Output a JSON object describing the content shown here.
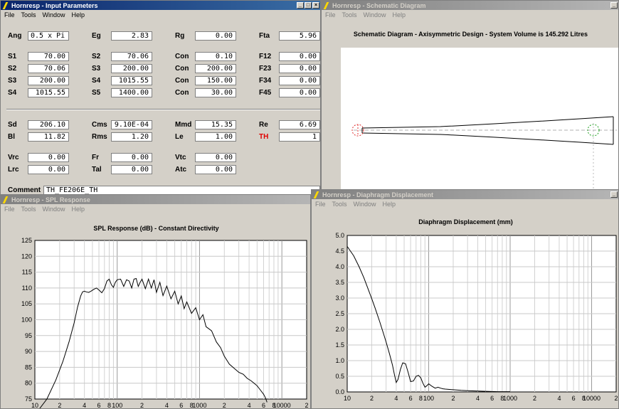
{
  "app_name": "Hornresp",
  "menus": [
    "File",
    "Tools",
    "Window",
    "Help"
  ],
  "windows": {
    "input": {
      "title": "Hornresp - Input Parameters"
    },
    "schematic": {
      "title": "Hornresp - Schematic Diagram",
      "heading": "Schematic Diagram - Axisymmetric Design - System Volume is 145.292 Litres"
    },
    "spl": {
      "title": "Hornresp - SPL Response"
    },
    "disp": {
      "title": "Hornresp - Diaphragm Displacement"
    }
  },
  "params": {
    "Ang": "0.5 x Pi",
    "Eg": "2.83",
    "Rg": "0.00",
    "Fta": "5.96",
    "S1a": "70.00",
    "S2a": "70.06",
    "Con1": "0.10",
    "F12": "0.00",
    "S2b": "70.06",
    "S3a": "200.00",
    "Con2": "200.00",
    "F23": "0.00",
    "S3b": "200.00",
    "S4a": "1015.55",
    "Con3": "150.00",
    "F34": "0.00",
    "S4b": "1015.55",
    "S5": "1400.00",
    "Con4": "30.00",
    "F45": "0.00",
    "Sd": "206.10",
    "Cms": "9.10E-04",
    "Mmd": "15.35",
    "Re": "6.69",
    "Bl": "11.82",
    "Rms": "1.20",
    "Le": "1.00",
    "TH": "1",
    "Vrc": "0.00",
    "Fr": "0.00",
    "Vtc": "0.00",
    "Lrc": "0.00",
    "Tal": "0.00",
    "Atc": "0.00",
    "Comment": "TH_FE206E_TH"
  },
  "labels": {
    "Ang": "Ang",
    "Eg": "Eg",
    "Rg": "Rg",
    "Fta": "Fta",
    "S1": "S1",
    "S2": "S2",
    "S3": "S3",
    "S4": "S4",
    "S5": "S5",
    "Con": "Con",
    "F12": "F12",
    "F23": "F23",
    "F34": "F34",
    "F45": "F45",
    "Sd": "Sd",
    "Cms": "Cms",
    "Mmd": "Mmd",
    "Re": "Re",
    "Bl": "Bl",
    "Rms": "Rms",
    "Le": "Le",
    "TH": "TH",
    "Vrc": "Vrc",
    "Fr": "Fr",
    "Vtc": "Vtc",
    "Lrc": "Lrc",
    "Tal": "Tal",
    "Atc": "Atc",
    "Comment": "Comment"
  },
  "colors": {
    "th_label": "#e00000",
    "title_active": "#0a246a",
    "source_circle": "#e03030",
    "mouth_circle": "#20a020"
  },
  "chart_data": [
    {
      "type": "line",
      "title": "SPL Response (dB) - Constant Directivity",
      "xscale": "log",
      "xlim": [
        10,
        20000
      ],
      "ylim": [
        75,
        125
      ],
      "yticks": [
        75,
        80,
        85,
        90,
        95,
        100,
        105,
        110,
        115,
        120,
        125
      ],
      "xtick_labels": [
        "10",
        "2",
        "4",
        "6",
        "8",
        "100",
        "2",
        "4",
        "6",
        "8",
        "1000",
        "2",
        "4",
        "6",
        "8",
        "10000",
        "2"
      ],
      "x": [
        10,
        14,
        18,
        22,
        26,
        30,
        33,
        36,
        38,
        40,
        42,
        45,
        48,
        52,
        56,
        60,
        65,
        70,
        75,
        80,
        85,
        90,
        95,
        100,
        110,
        120,
        130,
        140,
        150,
        160,
        170,
        180,
        190,
        200,
        220,
        240,
        260,
        280,
        300,
        330,
        360,
        400,
        450,
        500,
        550,
        600,
        650,
        700,
        800,
        900,
        1000,
        1100,
        1200,
        1400,
        1600,
        1800,
        2000,
        2300,
        2600,
        3000,
        3400,
        3800,
        4200,
        4600,
        5000,
        5500,
        6000,
        6300,
        6600
      ],
      "y": [
        70,
        75,
        81,
        87,
        93,
        99,
        104,
        107.5,
        108.8,
        109,
        108.8,
        108.6,
        109,
        109.6,
        110,
        109.4,
        108.5,
        109.8,
        112.2,
        112.8,
        111,
        110.2,
        111.8,
        112.6,
        112.8,
        110.5,
        112.6,
        112.2,
        110,
        112.8,
        113,
        110.5,
        111.8,
        112.8,
        109.8,
        112.8,
        110,
        112.6,
        108.6,
        111.8,
        107.6,
        110.6,
        106.6,
        109,
        105,
        107.5,
        103.5,
        105.6,
        102,
        103.8,
        100,
        101.6,
        97.8,
        96.5,
        93,
        91.2,
        88.5,
        86,
        84.8,
        83.4,
        82.8,
        81.5,
        80.8,
        80,
        79.2,
        77.8,
        76.5,
        75.5,
        74
      ]
    },
    {
      "type": "line",
      "title": "Diaphragm Displacement (mm)",
      "xscale": "log",
      "xlim": [
        10,
        20000
      ],
      "ylim": [
        0,
        5
      ],
      "yticks": [
        "0.0",
        "0.5",
        "1.0",
        "1.5",
        "2.0",
        "2.5",
        "3.0",
        "3.5",
        "4.0",
        "4.5",
        "5.0"
      ],
      "xtick_labels": [
        "10",
        "2",
        "4",
        "6",
        "8",
        "100",
        "2",
        "4",
        "6",
        "8",
        "1000",
        "2",
        "4",
        "6",
        "8",
        "10000",
        "2"
      ],
      "x": [
        10,
        12,
        14,
        16,
        18,
        20,
        22,
        25,
        28,
        30,
        33,
        36,
        38,
        40,
        42,
        45,
        48,
        52,
        56,
        60,
        65,
        70,
        75,
        80,
        85,
        90,
        95,
        100,
        110,
        120,
        130,
        140,
        150,
        160,
        180,
        200,
        250,
        300,
        400,
        500,
        700,
        1000
      ],
      "y": [
        4.65,
        4.35,
        4.0,
        3.65,
        3.3,
        2.98,
        2.68,
        2.25,
        1.85,
        1.6,
        1.22,
        0.85,
        0.55,
        0.3,
        0.4,
        0.72,
        0.93,
        0.9,
        0.62,
        0.33,
        0.35,
        0.5,
        0.53,
        0.45,
        0.28,
        0.15,
        0.2,
        0.26,
        0.18,
        0.12,
        0.15,
        0.12,
        0.1,
        0.09,
        0.08,
        0.07,
        0.05,
        0.04,
        0.03,
        0.02,
        0.01,
        0.01
      ]
    }
  ]
}
